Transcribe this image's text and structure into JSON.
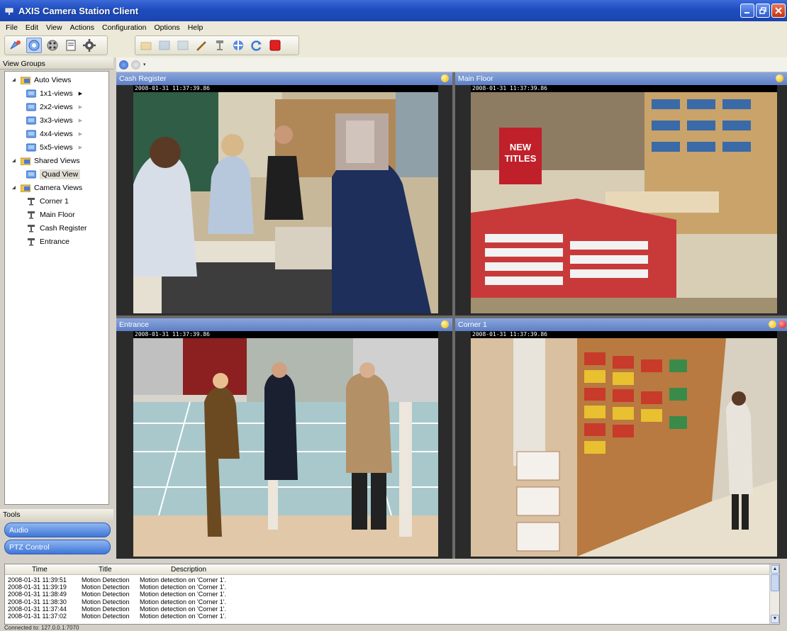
{
  "window": {
    "title": "AXIS Camera Station Client",
    "controls": [
      "minimize-icon",
      "restore-icon",
      "close-icon"
    ]
  },
  "menu": [
    "File",
    "Edit",
    "View",
    "Actions",
    "Configuration",
    "Options",
    "Help"
  ],
  "toolbar": {
    "group1": [
      "live-view-icon",
      "quad-view-icon",
      "recordings-icon",
      "report-icon",
      "settings-gear-icon"
    ],
    "group2": [
      "snapshot-icon",
      "zoom-icon",
      "layout-icon",
      "draw-pen-icon",
      "ptz-icon",
      "network-icon",
      "refresh-icon",
      "record-stop-icon"
    ]
  },
  "left_panel": {
    "header": "View Groups",
    "tree": [
      {
        "label": "Auto Views",
        "level": 0,
        "type": "folder"
      },
      {
        "label": "1x1-views",
        "level": 1,
        "type": "view",
        "arrow": true
      },
      {
        "label": "2x2-views",
        "level": 1,
        "type": "view",
        "arrow": true
      },
      {
        "label": "3x3-views",
        "level": 1,
        "type": "view",
        "arrow": true
      },
      {
        "label": "4x4-views",
        "level": 1,
        "type": "view",
        "arrow": true
      },
      {
        "label": "5x5-views",
        "level": 1,
        "type": "view",
        "arrow": true
      },
      {
        "label": "Shared Views",
        "level": 0,
        "type": "folder"
      },
      {
        "label": "Quad View",
        "level": 1,
        "type": "view",
        "selected": true
      },
      {
        "label": "Camera Views",
        "level": 0,
        "type": "folder"
      },
      {
        "label": "Corner 1",
        "level": 1,
        "type": "camera"
      },
      {
        "label": "Main Floor",
        "level": 1,
        "type": "camera"
      },
      {
        "label": "Cash Register",
        "level": 1,
        "type": "camera"
      },
      {
        "label": "Entrance",
        "level": 1,
        "type": "camera"
      }
    ]
  },
  "tools": {
    "header": "Tools",
    "items": [
      "Audio",
      "PTZ Control"
    ]
  },
  "cameras": [
    {
      "name": "Cash Register",
      "timestamp": "2008-01-31 11:37:39.86"
    },
    {
      "name": "Main Floor",
      "timestamp": "2008-01-31 11:37:39.86"
    },
    {
      "name": "Entrance",
      "timestamp": "2008-01-31 11:37:39.86"
    },
    {
      "name": "Corner 1",
      "timestamp": "2008-01-31 11:37:39.86"
    }
  ],
  "scene_text": {
    "new_titles": [
      "NEW",
      "TITLES"
    ]
  },
  "event_log": {
    "columns": [
      "Time",
      "Title",
      "Description"
    ],
    "rows": [
      [
        "2008-01-31 11:39:51",
        "Motion Detection",
        "Motion detection on 'Corner 1'."
      ],
      [
        "2008-01-31 11:39:19",
        "Motion Detection",
        "Motion detection on 'Corner 1'."
      ],
      [
        "2008-01-31 11:38:49",
        "Motion Detection",
        "Motion detection on 'Corner 1'."
      ],
      [
        "2008-01-31 11:38:30",
        "Motion Detection",
        "Motion detection on 'Corner 1'."
      ],
      [
        "2008-01-31 11:37:44",
        "Motion Detection",
        "Motion detection on 'Corner 1'."
      ],
      [
        "2008-01-31 11:37:02",
        "Motion Detection",
        "Motion detection on 'Corner 1'."
      ]
    ]
  },
  "status": "Connected to: 127.0.0.1:7070"
}
